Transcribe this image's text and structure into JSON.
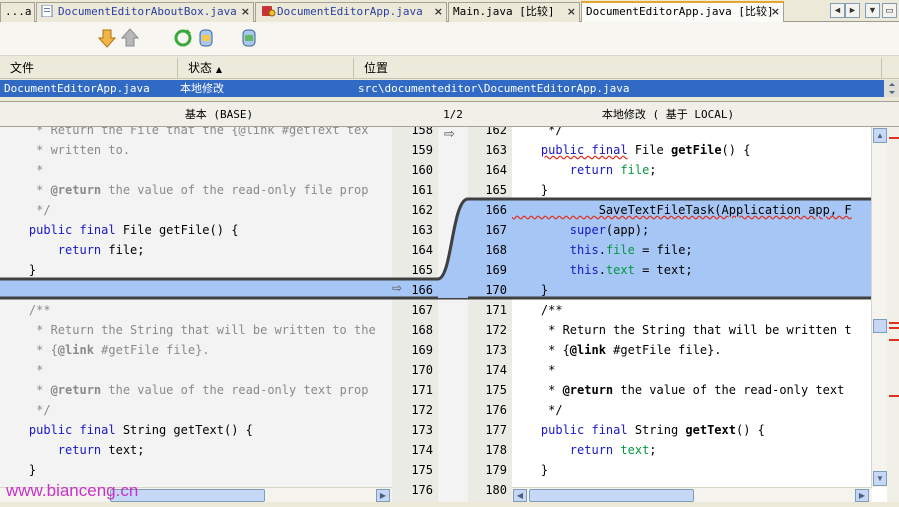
{
  "tabs": [
    {
      "label": "...a",
      "close": ""
    },
    {
      "label": "DocumentEditorAboutBox.java",
      "close": "×"
    },
    {
      "label": "DocumentEditorApp.java",
      "close": "×"
    },
    {
      "label": "Main.java [比较]",
      "close": "×"
    },
    {
      "label": "DocumentEditorApp.java [比较]",
      "close": "×"
    }
  ],
  "nav": {
    "prev": "◄",
    "next": "►",
    "menu": "▼",
    "restore": "▭"
  },
  "table": {
    "col_file": "文件",
    "col_status": "状态",
    "col_status_sort": "▲",
    "col_location": "位置",
    "row": {
      "file": "DocumentEditorApp.java",
      "status": "本地修改",
      "location": "src\\documenteditor\\DocumentEditorApp.java"
    }
  },
  "diff_header": {
    "base": "基本 (BASE)",
    "counter": "1/2",
    "local": "本地修改 ( 基于 LOCAL)"
  },
  "left_numbers": [
    "158",
    "159",
    "160",
    "161",
    "162",
    "163",
    "164",
    "165",
    "166",
    "167",
    "168",
    "169",
    "170",
    "171",
    "172",
    "173",
    "174",
    "175",
    "176"
  ],
  "right_numbers": [
    "162",
    "163",
    "164",
    "165",
    "166",
    "167",
    "168",
    "169",
    "170",
    "171",
    "172",
    "173",
    "174",
    "175",
    "176",
    "177",
    "178",
    "179",
    "180"
  ],
  "left_code": {
    "l0": "     * Return the File that the {@link #getText tex",
    "l1": "     * written to.",
    "l2": "     *",
    "l3a": "     * ",
    "l3b": "@return",
    "l3c": " the value of the read-only file prop",
    "l4": "     */",
    "l5a": "    ",
    "l5b": "public final",
    "l5c": " File getFile() {",
    "l6a": "        ",
    "l6b": "return",
    "l6c": " file;",
    "l7": "    }",
    "l9": "    /**",
    "l10": "     * Return the String that will be written to the",
    "l11a": "     * {",
    "l11b": "@link",
    "l11c": " #getFile file}.",
    "l12": "     *",
    "l13a": "     * ",
    "l13b": "@return",
    "l13c": " the value of the read-only text prop",
    "l14": "     */",
    "l15a": "    ",
    "l15b": "public final",
    "l15c": " String getText() {",
    "l16a": "        ",
    "l16b": "return",
    "l16c": " text;",
    "l17": "    }"
  },
  "right_code": {
    "r0": "     */",
    "r1a": "    ",
    "r1b": "public final",
    "r1c": " File ",
    "r1d": "getFile",
    "r1e": "() {",
    "r2a": "        ",
    "r2b": "return",
    "r2c": " ",
    "r2d": "file",
    "r2e": ";",
    "r3": "    }",
    "r4": "            SaveTextFileTask(Application app, F",
    "r5a": "        ",
    "r5b": "super",
    "r5c": "(app);",
    "r6a": "        ",
    "r6b": "this",
    "r6c": ".",
    "r6d": "file",
    "r6e": " = file;",
    "r7a": "        ",
    "r7b": "this",
    "r7c": ".",
    "r7d": "text",
    "r7e": " = text;",
    "r8": "    }",
    "r9": "    /**",
    "r10": "     * Return the String that will be written t",
    "r11a": "     * {",
    "r11b": "@link",
    "r11c": " #getFile file}.",
    "r12": "     *",
    "r13a": "     * ",
    "r13b": "@return",
    "r13c": " the value of the read-only text",
    "r14": "     */",
    "r15a": "    ",
    "r15b": "public final",
    "r15c": " String ",
    "r15d": "getText",
    "r15e": "() {",
    "r16a": "        ",
    "r16b": "return",
    "r16c": " ",
    "r16d": "text",
    "r16e": ";",
    "r17": "    }"
  },
  "gutter": {
    "arrow_top": "⇨",
    "arrow_left": "⇨"
  },
  "watermark": "www.bianceng.cn",
  "colors": {
    "added": "#a6c6f5",
    "selection": "#316ac5",
    "keyword": "#1818c8",
    "field": "#009a3e",
    "comment": "#8a8a8a"
  }
}
